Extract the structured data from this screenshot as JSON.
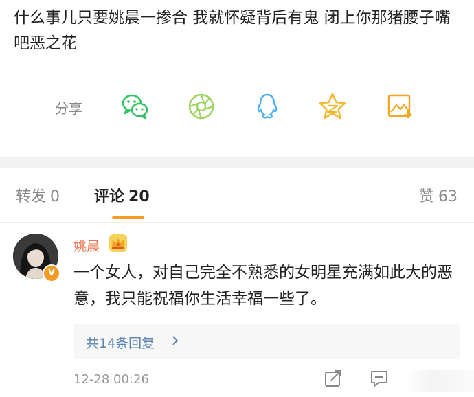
{
  "post": {
    "text": "什么事儿只要姚晨一掺合 我就怀疑背后有鬼 闭上你那猪腰子嘴吧恶之花"
  },
  "share": {
    "label": "分享",
    "icons": [
      "wechat-icon",
      "moments-icon",
      "qq-icon",
      "qzone-icon",
      "save-image-icon"
    ]
  },
  "tabs": {
    "repost": {
      "label": "转发",
      "count": "0"
    },
    "comment": {
      "label": "评论",
      "count": "20"
    },
    "like": {
      "label": "赞",
      "count": "63"
    }
  },
  "comment": {
    "username": "姚晨",
    "verified_badge": "V",
    "text": "一个女人，对自己完全不熟悉的女明星充满如此大的恶意，我只能祝福你生活幸福一些了。",
    "replies_label": "共14条回复",
    "timestamp": "12-28 00:26"
  },
  "colors": {
    "accent": "#f59a23",
    "username": "#eb7350",
    "link": "#5b84b1",
    "wechat": "#2fc261",
    "qq": "#4ab0ef"
  }
}
